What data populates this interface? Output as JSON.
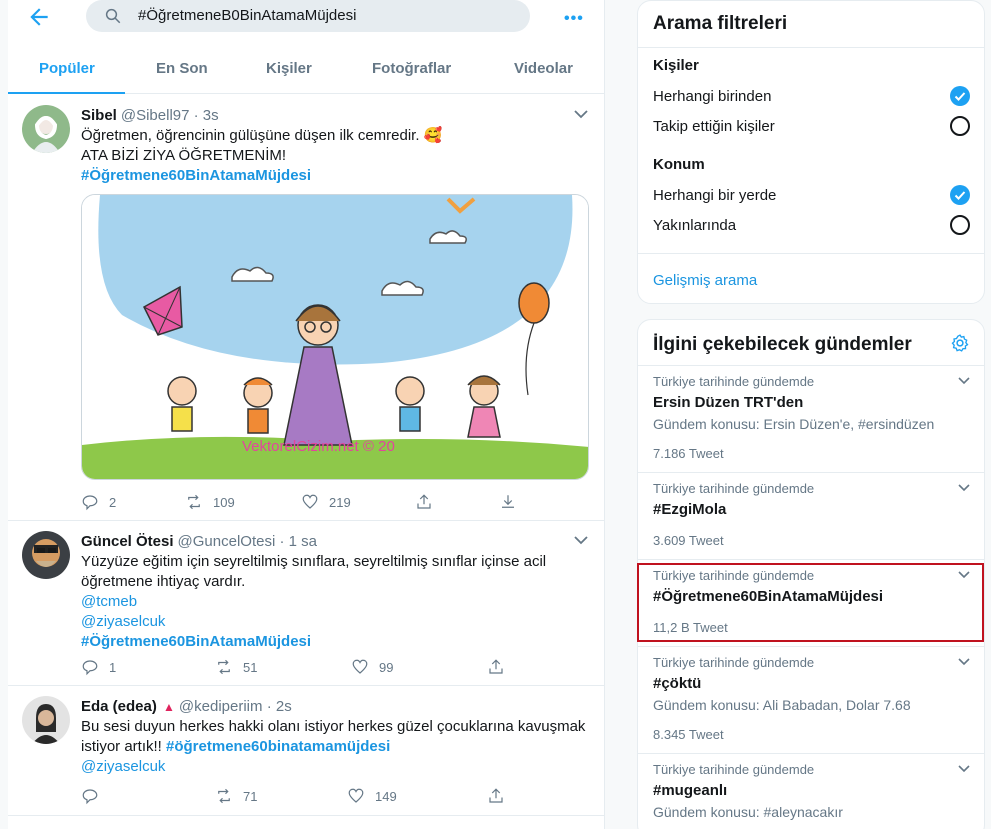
{
  "search": {
    "query": "#ÖğretmeneB0BinAtamaMüjdesi"
  },
  "tabs": [
    {
      "label": "Popüler"
    },
    {
      "label": "En Son"
    },
    {
      "label": "Kişiler"
    },
    {
      "label": "Fotoğraflar"
    },
    {
      "label": "Videolar"
    }
  ],
  "tweets": [
    {
      "name": "Sibel",
      "handle": "@Sibell97",
      "time": "· 3s",
      "lines": [
        "Öğretmen, öğrencinin gülüşüne düşen ilk cemredir. 🥰",
        "ATA BİZİ ZİYA ÖĞRETMENİM!"
      ],
      "hashtag": "#Öğretmene60BinAtamaMüjdesi",
      "watermark": "VektorelCizim.net © 20",
      "replies": "2",
      "retweets": "109",
      "likes": "219"
    },
    {
      "name": "Güncel Ötesi",
      "handle": "@GuncelOtesi",
      "time": "· 1 sa",
      "lines": [
        "Yüzyüze eğitim için seyreltilmiş sınıflara, seyreltilmiş sınıflar içinse acil",
        "öğretmene ihtiyaç vardır."
      ],
      "mentions": [
        "@tcmeb",
        "@ziyaselcuk"
      ],
      "hashtag": "#Öğretmene60BinAtamaMüjdesi",
      "replies": "1",
      "retweets": "51",
      "likes": "99"
    },
    {
      "name": "Eda (edea)",
      "handle": "@kediperiim",
      "time": "· 2s",
      "lines": [
        "Bu sesi duyun herkes hakki olanı istiyor herkes güzel çocuklarına kavuşmak"
      ],
      "line2_prefix": "istiyor artık!! ",
      "hashtag": "#öğretmene60binatamamüjdesi",
      "mention": "@ziyaselcuk",
      "replies": "",
      "retweets": "71",
      "likes": "149"
    }
  ],
  "filters": {
    "title": "Arama filtreleri",
    "people_label": "Kişiler",
    "people_opts": [
      "Herhangi birinden",
      "Takip ettiğin kişiler"
    ],
    "location_label": "Konum",
    "location_opts": [
      "Herhangi bir yerde",
      "Yakınlarında"
    ],
    "advanced": "Gelişmiş arama"
  },
  "trends": {
    "title": "İlgini çekebilecek gündemler",
    "items": [
      {
        "context": "Türkiye tarihinde gündemde",
        "name": "Ersin Düzen TRT'den",
        "sub": "Gündem konusu: Ersin Düzen'e, #ersindüzen",
        "count": "7.186 Tweet"
      },
      {
        "context": "Türkiye tarihinde gündemde",
        "name": "#EzgiMola",
        "sub": "",
        "count": "3.609 Tweet"
      },
      {
        "context": "Türkiye tarihinde gündemde",
        "name": "#Öğretmene60BinAtamaMüjdesi",
        "sub": "",
        "count": "11,2 B Tweet"
      },
      {
        "context": "Türkiye tarihinde gündemde",
        "name": "#çöktü",
        "sub": "Gündem konusu: Ali Babadan, Dolar 7.68",
        "count": "8.345 Tweet"
      },
      {
        "context": "Türkiye tarihinde gündemde",
        "name": "#mugeanlı",
        "sub": "Gündem konusu: #aleynacakır",
        "count": ""
      }
    ]
  }
}
